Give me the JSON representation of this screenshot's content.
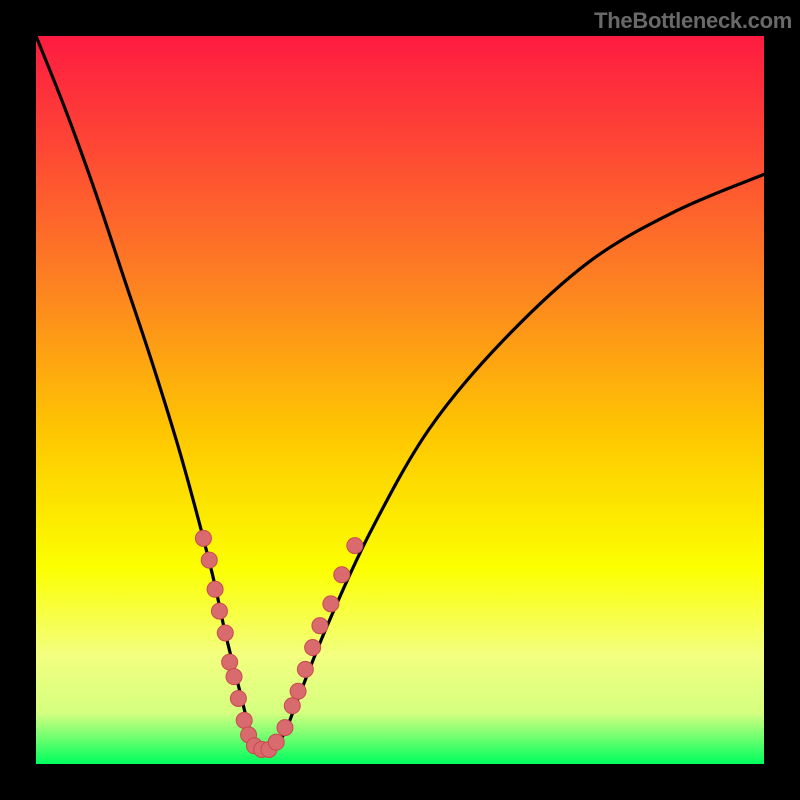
{
  "watermark": "TheBottleneck.com",
  "colors": {
    "background": "#000000",
    "curve": "#000000",
    "marker_fill": "#d96a6e",
    "marker_stroke": "#c84a50",
    "gradient_top": "#fe1b41",
    "gradient_bottom": "#00ff5e"
  },
  "chart_data": {
    "type": "line",
    "title": "",
    "xlabel": "",
    "ylabel": "",
    "xlim": [
      0,
      100
    ],
    "ylim": [
      0,
      100
    ],
    "grid": false,
    "legend": false,
    "annotations": [],
    "series": [
      {
        "name": "bottleneck-curve",
        "x": [
          0,
          4,
          8,
          12,
          16,
          20,
          24,
          26,
          28,
          29,
          30,
          31,
          32,
          34,
          36,
          40,
          46,
          54,
          64,
          76,
          88,
          100
        ],
        "values": [
          100,
          90,
          79,
          67,
          55,
          42,
          27,
          18,
          10,
          6,
          3,
          2,
          2,
          4,
          9,
          19,
          32,
          46,
          58,
          69,
          76,
          81
        ]
      }
    ],
    "markers": [
      {
        "x": 23.0,
        "y": 31
      },
      {
        "x": 23.8,
        "y": 28
      },
      {
        "x": 24.6,
        "y": 24
      },
      {
        "x": 25.2,
        "y": 21
      },
      {
        "x": 26.0,
        "y": 18
      },
      {
        "x": 26.6,
        "y": 14
      },
      {
        "x": 27.2,
        "y": 12
      },
      {
        "x": 27.8,
        "y": 9
      },
      {
        "x": 28.6,
        "y": 6
      },
      {
        "x": 29.2,
        "y": 4
      },
      {
        "x": 30.0,
        "y": 2.5
      },
      {
        "x": 31.0,
        "y": 2
      },
      {
        "x": 32.0,
        "y": 2
      },
      {
        "x": 33.0,
        "y": 3
      },
      {
        "x": 34.2,
        "y": 5
      },
      {
        "x": 35.2,
        "y": 8
      },
      {
        "x": 36.0,
        "y": 10
      },
      {
        "x": 37.0,
        "y": 13
      },
      {
        "x": 38.0,
        "y": 16
      },
      {
        "x": 39.0,
        "y": 19
      },
      {
        "x": 40.5,
        "y": 22
      },
      {
        "x": 42.0,
        "y": 26
      },
      {
        "x": 43.8,
        "y": 30
      }
    ],
    "marker_radius": 8
  }
}
